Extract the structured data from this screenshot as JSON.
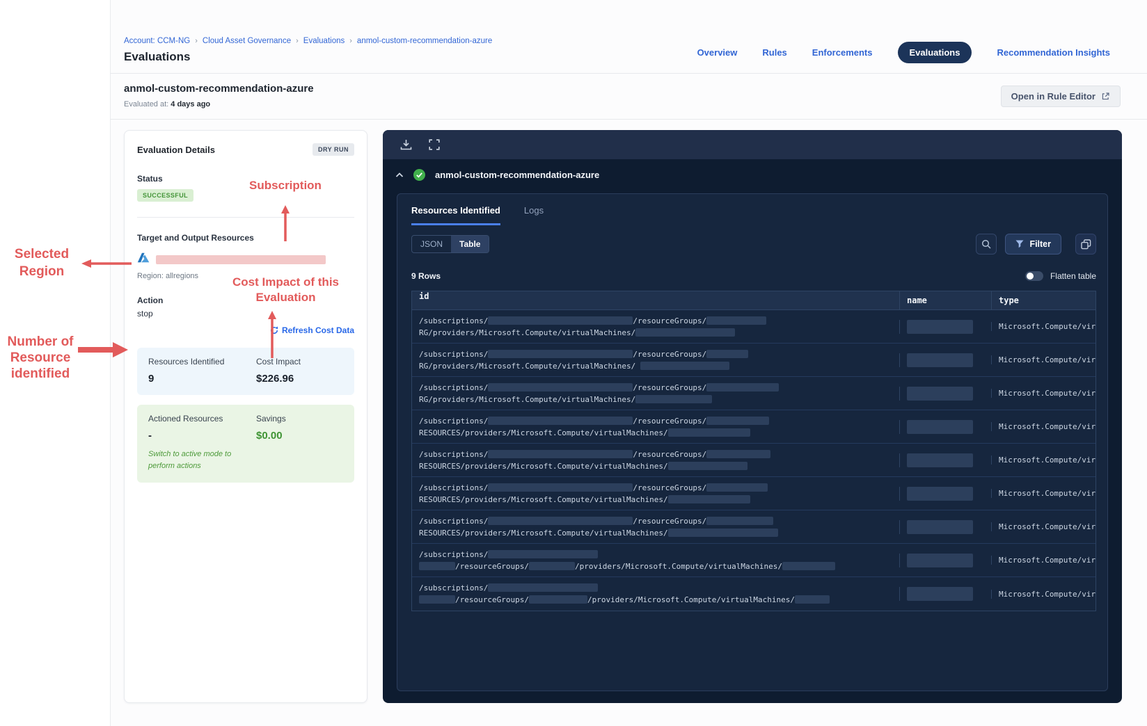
{
  "colors": {
    "accent_blue": "#3266d5",
    "annotation_red": "#e25b5b",
    "success_green": "#3f9434",
    "panel_navy": "#0e1c30",
    "active_pill_navy": "#1c3459"
  },
  "header": {
    "breadcrumb": [
      {
        "label": "Account: CCM-NG"
      },
      {
        "label": "Cloud Asset Governance"
      },
      {
        "label": "Evaluations"
      },
      {
        "label": "anmol-custom-recommendation-azure"
      }
    ],
    "separator": "›",
    "page_title": "Evaluations",
    "nav_tabs": [
      {
        "label": "Overview",
        "active": false
      },
      {
        "label": "Rules",
        "active": false
      },
      {
        "label": "Enforcements",
        "active": false
      },
      {
        "label": "Evaluations",
        "active": true
      },
      {
        "label": "Recommendation Insights",
        "active": false
      }
    ]
  },
  "subheader": {
    "title": "anmol-custom-recommendation-azure",
    "evaluated_label": "Evaluated at:",
    "evaluated_value": "4 days ago",
    "open_rule_editor_label": "Open in Rule Editor"
  },
  "details_card": {
    "title": "Evaluation Details",
    "dry_run_badge": "DRY RUN",
    "status_label": "Status",
    "status_value": "SUCCESSFUL",
    "target_label": "Target and Output Resources",
    "cloud_icon": "azure-icon",
    "region_label": "Region: allregions",
    "action_label": "Action",
    "action_value": "stop",
    "refresh_link": "Refresh Cost Data",
    "resources_identified_label": "Resources Identified",
    "resources_identified_value": "9",
    "cost_impact_label": "Cost Impact",
    "cost_impact_value": "$226.96",
    "actioned_label": "Actioned Resources",
    "actioned_value": "-",
    "savings_label": "Savings",
    "savings_value": "$0.00",
    "switch_note_line1": "Switch to active mode to",
    "switch_note_line2": "perform actions"
  },
  "results_panel": {
    "toolbar_icons": [
      "download-icon",
      "fullscreen-icon"
    ],
    "section_title": "anmol-custom-recommendation-azure",
    "section_status_icon": "check-circle-icon",
    "tabs": [
      {
        "label": "Resources Identified",
        "active": true
      },
      {
        "label": "Logs",
        "active": false
      }
    ],
    "view_toggle": [
      {
        "label": "JSON",
        "active": false
      },
      {
        "label": "Table",
        "active": true
      }
    ],
    "filter_label": "Filter",
    "rows_count": "9 Rows",
    "flatten_label": "Flatten table",
    "table": {
      "columns": [
        "id",
        "name",
        "type"
      ],
      "type_value": "Microsoft.Compute/virtu",
      "rows": [
        {
          "line1": [
            {
              "t": "/subscriptions/"
            },
            {
              "b": 208
            },
            {
              "t": "/resourceGroups/"
            },
            {
              "b": 86
            }
          ],
          "line2": [
            {
              "t": "RG/providers/Microsoft.Compute/virtualMachines/"
            },
            {
              "b": 143
            }
          ],
          "name_bar": 95
        },
        {
          "line1": [
            {
              "t": "/subscriptions/"
            },
            {
              "b": 208
            },
            {
              "t": "/resourceGroups/"
            },
            {
              "b": 60
            }
          ],
          "line2": [
            {
              "t": "RG/providers/Microsoft.Compute/virtualMachines/ "
            },
            {
              "b": 128
            }
          ],
          "name_bar": 95
        },
        {
          "line1": [
            {
              "t": "/subscriptions/"
            },
            {
              "b": 208
            },
            {
              "t": "/resourceGroups/"
            },
            {
              "b": 104
            }
          ],
          "line2": [
            {
              "t": "RG/providers/Microsoft.Compute/virtualMachines/"
            },
            {
              "b": 110
            }
          ],
          "name_bar": 95
        },
        {
          "line1": [
            {
              "t": "/subscriptions/"
            },
            {
              "b": 208
            },
            {
              "t": "/resourceGroups/"
            },
            {
              "b": 90
            }
          ],
          "line2": [
            {
              "t": "RESOURCES/providers/Microsoft.Compute/virtualMachines/"
            },
            {
              "b": 118
            }
          ],
          "name_bar": 95
        },
        {
          "line1": [
            {
              "t": "/subscriptions/"
            },
            {
              "b": 208
            },
            {
              "t": "/resourceGroups/"
            },
            {
              "b": 92
            }
          ],
          "line2": [
            {
              "t": "RESOURCES/providers/Microsoft.Compute/virtualMachines/"
            },
            {
              "b": 114
            }
          ],
          "name_bar": 95
        },
        {
          "line1": [
            {
              "t": "/subscriptions/"
            },
            {
              "b": 208
            },
            {
              "t": "/resourceGroups/"
            },
            {
              "b": 88
            }
          ],
          "line2": [
            {
              "t": "RESOURCES/providers/Microsoft.Compute/virtualMachines/"
            },
            {
              "b": 118
            }
          ],
          "name_bar": 95
        },
        {
          "line1": [
            {
              "t": "/subscriptions/"
            },
            {
              "b": 208
            },
            {
              "t": "/resourceGroups/"
            },
            {
              "b": 96
            }
          ],
          "line2": [
            {
              "t": "RESOURCES/providers/Microsoft.Compute/virtualMachines/"
            },
            {
              "b": 158
            }
          ],
          "name_bar": 95
        },
        {
          "line1": [
            {
              "t": "/subscriptions/"
            },
            {
              "b": 158
            }
          ],
          "line2": [
            {
              "b": 52
            },
            {
              "t": "/resourceGroups/"
            },
            {
              "b": 66
            },
            {
              "t": "/providers/Microsoft.Compute/virtualMachines/"
            },
            {
              "b": 76
            }
          ],
          "name_bar": 95
        },
        {
          "line1": [
            {
              "t": "/subscriptions/"
            },
            {
              "b": 158
            }
          ],
          "line2": [
            {
              "b": 52
            },
            {
              "t": "/resourceGroups/"
            },
            {
              "b": 84
            },
            {
              "t": "/providers/Microsoft.Compute/virtualMachines/"
            },
            {
              "b": 50
            }
          ],
          "name_bar": 95
        }
      ]
    }
  },
  "annotations": {
    "subscription": "Subscription",
    "cost_impact_line1": "Cost Impact of this",
    "cost_impact_line2": "Evaluation",
    "selected_region_line1": "Selected",
    "selected_region_line2": "Region",
    "num_resources_line1": "Number of",
    "num_resources_line2": "Resource",
    "num_resources_line3": "identified"
  }
}
